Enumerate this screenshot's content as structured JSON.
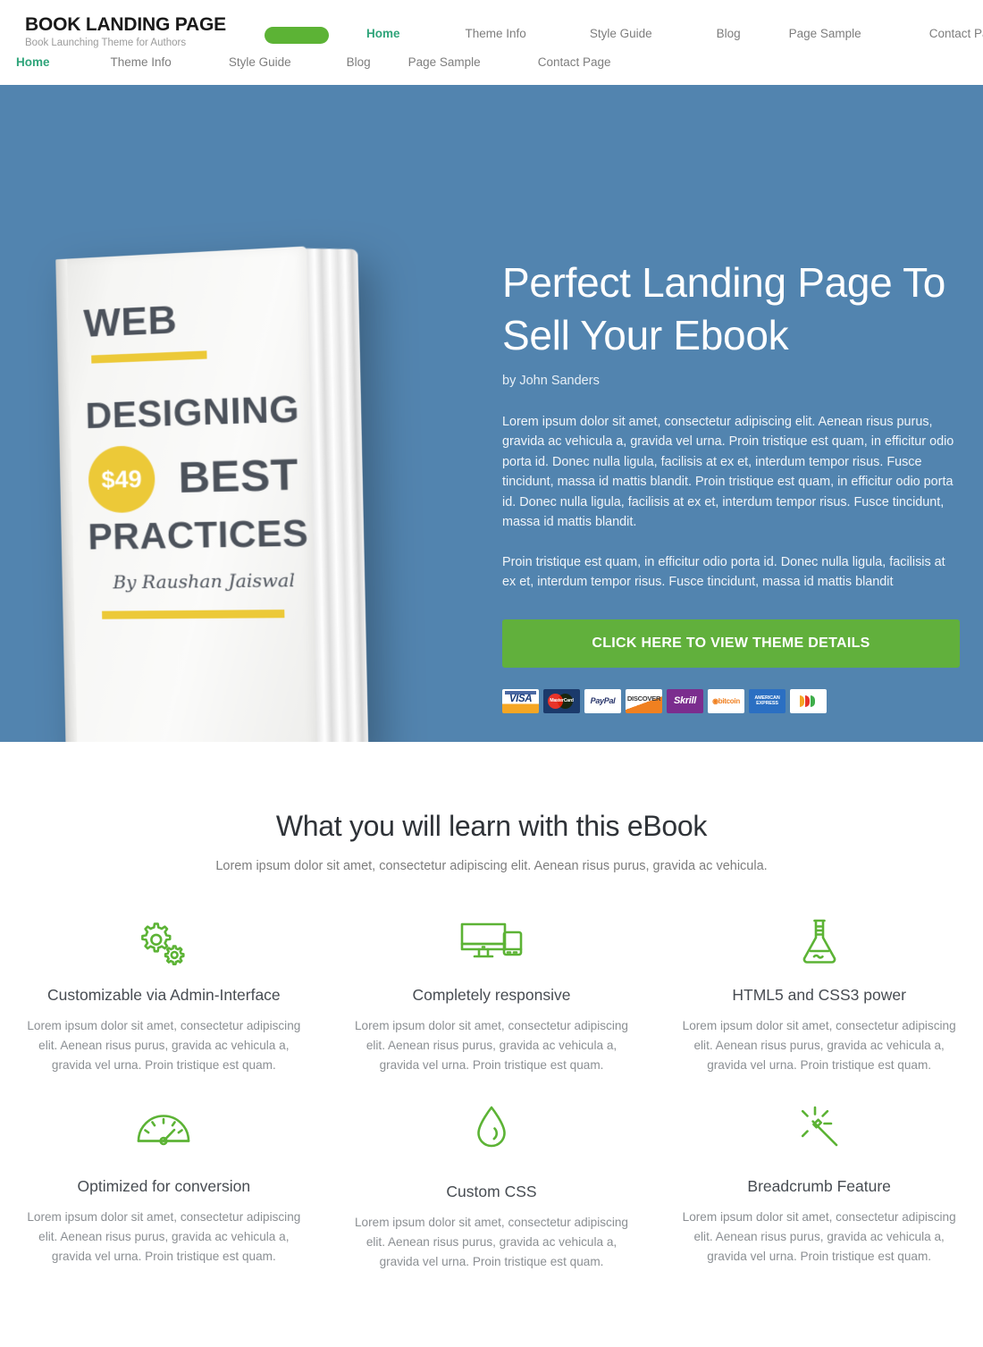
{
  "header": {
    "brand_title": "BOOK LANDING PAGE",
    "brand_tagline": "Book Launching Theme for Authors",
    "accent_green": "#5cb335",
    "active_color": "#2fa47a",
    "nav_primary": [
      {
        "label": "Home",
        "active": true
      },
      {
        "label": "Theme Info",
        "active": false
      },
      {
        "label": "Style Guide",
        "active": false
      },
      {
        "label": "Blog",
        "active": false
      },
      {
        "label": "Page Sample",
        "active": false
      },
      {
        "label": "Contact Page",
        "active": false
      }
    ],
    "nav_secondary": [
      {
        "label": "Home",
        "active": true
      },
      {
        "label": "Theme Info",
        "active": false
      },
      {
        "label": "Style Guide",
        "active": false
      },
      {
        "label": "Blog",
        "active": false
      },
      {
        "label": "Page Sample",
        "active": false
      },
      {
        "label": "Contact Page",
        "active": false
      }
    ]
  },
  "hero": {
    "background_color": "#5284af",
    "title": "Perfect Landing Page To Sell Your Ebook",
    "byline": "by John Sanders",
    "paragraph_1": "Lorem ipsum dolor sit amet, consectetur adipiscing elit. Aenean risus purus, gravida ac vehicula a, gravida vel urna. Proin tristique est quam, in efficitur odio porta id. Donec nulla ligula, facilisis at ex et, interdum tempor risus. Fusce tincidunt, massa id mattis blandit. Proin tristique est quam, in efficitur odio porta id. Donec nulla ligula, facilisis at ex et, interdum tempor risus. Fusce tincidunt, massa id mattis blandit.",
    "paragraph_2": "Proin tristique est quam, in efficitur odio porta id. Donec nulla ligula, facilisis at ex et, interdum tempor risus. Fusce tincidunt, massa id mattis blandit",
    "cta_label": "CLICK HERE TO VIEW THEME DETAILS",
    "cta_color": "#61b03c",
    "book": {
      "line1": "WEB",
      "line2": "DESIGNING",
      "price": "$49",
      "line3": "BEST",
      "line4": "PRACTICES",
      "author": "By Raushan Jaiswal",
      "accent_color": "#ecc938"
    },
    "payments": [
      {
        "name": "visa",
        "label": "VISA"
      },
      {
        "name": "mastercard",
        "label": "MasterCard"
      },
      {
        "name": "paypal",
        "label": "PayPal"
      },
      {
        "name": "discover",
        "label": "DISCOVER"
      },
      {
        "name": "skrill",
        "label": "Skrill"
      },
      {
        "name": "bitcoin",
        "label": "bitcoin"
      },
      {
        "name": "american-express",
        "label": "AMERICAN EXPRESS"
      },
      {
        "name": "google-wallet",
        "label": ""
      }
    ]
  },
  "features": {
    "title": "What you will learn with this eBook",
    "subtitle": "Lorem ipsum dolor sit amet, consectetur adipiscing elit. Aenean risus purus, gravida ac vehicula.",
    "icon_color": "#5cb335",
    "items": [
      {
        "icon": "gears-icon",
        "title": "Customizable via Admin-Interface",
        "desc": "Lorem ipsum dolor sit amet, consectetur adipiscing elit. Aenean risus purus, gravida ac vehicula a, gravida vel urna. Proin tristique est quam."
      },
      {
        "icon": "devices-icon",
        "title": "Completely responsive",
        "desc": "Lorem ipsum dolor sit amet, consectetur adipiscing elit. Aenean risus purus, gravida ac vehicula a, gravida vel urna. Proin tristique est quam."
      },
      {
        "icon": "flask-icon",
        "title": "HTML5 and CSS3 power",
        "desc": "Lorem ipsum dolor sit amet, consectetur adipiscing elit. Aenean risus purus, gravida ac vehicula a, gravida vel urna. Proin tristique est quam."
      },
      {
        "icon": "speedometer-icon",
        "title": "Optimized for conversion",
        "desc": "Lorem ipsum dolor sit amet, consectetur adipiscing elit. Aenean risus purus, gravida ac vehicula a, gravida vel urna. Proin tristique est quam."
      },
      {
        "icon": "droplet-icon",
        "title": "Custom CSS",
        "desc": "Lorem ipsum dolor sit amet, consectetur adipiscing elit. Aenean risus purus, gravida ac vehicula a, gravida vel urna. Proin tristique est quam."
      },
      {
        "icon": "magic-wand-icon",
        "title": "Breadcrumb Feature",
        "desc": "Lorem ipsum dolor sit amet, consectetur adipiscing elit. Aenean risus purus, gravida ac vehicula a, gravida vel urna. Proin tristique est quam."
      }
    ]
  }
}
